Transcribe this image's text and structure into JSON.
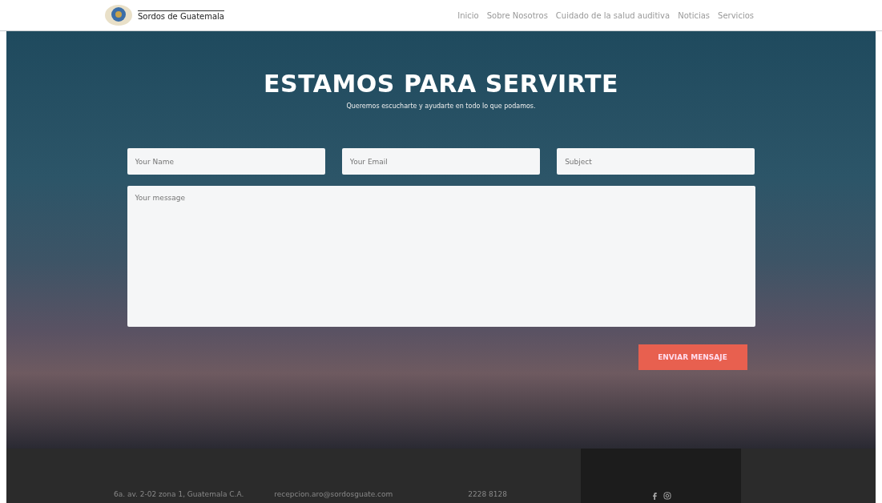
{
  "header": {
    "logo_text": "Sordos de Guatemala",
    "nav": [
      {
        "label": "Inicio",
        "selected": false
      },
      {
        "label": "Sobre Nosotros",
        "selected": false
      },
      {
        "label": "Cuidado de la salud auditiva",
        "selected": false
      },
      {
        "label": "Noticias",
        "selected": false
      },
      {
        "label": "Servicios",
        "selected": false
      }
    ]
  },
  "hero": {
    "title": "ESTAMOS PARA SERVIRTE",
    "subtitle": "Queremos escucharte y ayudarte en todo lo que podamos."
  },
  "form": {
    "fields": [
      {
        "placeholder": "Your Name"
      },
      {
        "placeholder": "Your Email"
      },
      {
        "placeholder": "Subject"
      }
    ],
    "message": {
      "placeholder": "Your message"
    },
    "submit": "ENVIAR MENSAJE"
  },
  "footer": {
    "address": "6a. av. 2-02 zona 1, Guatemala C.A.",
    "email": "recepcion.aro@sordosguate.com",
    "phone": "2228 8128"
  }
}
